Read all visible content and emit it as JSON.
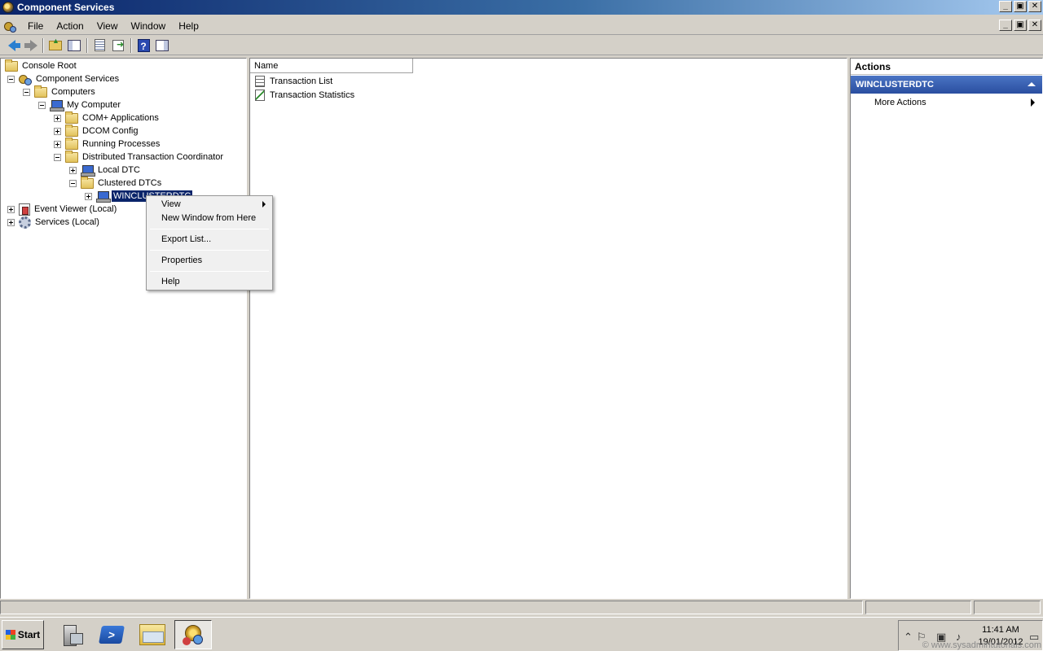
{
  "window": {
    "title": "Component Services",
    "controls": [
      "_",
      "▣",
      "✕"
    ]
  },
  "menubar": {
    "items": [
      "File",
      "Action",
      "View",
      "Window",
      "Help"
    ]
  },
  "toolbar": {
    "buttons": [
      "back-icon",
      "forward-icon",
      "up-one-level-icon",
      "show-hide-console-tree-icon",
      "export-list-icon",
      "export-icon",
      "help-icon",
      "show-hide-action-pane-icon"
    ]
  },
  "tree": {
    "nodes": [
      {
        "label": "Console Root",
        "icon": "folder-icon"
      },
      {
        "label": "Component Services",
        "icon": "component-services-icon",
        "state": "expanded"
      },
      {
        "label": "Computers",
        "icon": "folder-icon",
        "state": "expanded"
      },
      {
        "label": "My Computer",
        "icon": "computer-icon",
        "state": "expanded"
      },
      {
        "label": "COM+ Applications",
        "icon": "folder-icon",
        "state": "collapsed"
      },
      {
        "label": "DCOM Config",
        "icon": "folder-icon",
        "state": "collapsed"
      },
      {
        "label": "Running Processes",
        "icon": "folder-icon",
        "state": "collapsed"
      },
      {
        "label": "Distributed Transaction Coordinator",
        "icon": "folder-icon",
        "state": "expanded"
      },
      {
        "label": "Local DTC",
        "icon": "computer-icon",
        "state": "collapsed"
      },
      {
        "label": "Clustered DTCs",
        "icon": "folder-icon",
        "state": "expanded"
      },
      {
        "label": "WINCLUSTERDTC",
        "icon": "computer-icon",
        "state": "collapsed",
        "selected": true
      },
      {
        "label": "Event Viewer (Local)",
        "icon": "event-viewer-icon",
        "state": "collapsed"
      },
      {
        "label": "Services (Local)",
        "icon": "services-gear-icon",
        "state": "collapsed"
      }
    ]
  },
  "list": {
    "columns": [
      "Name"
    ],
    "rows": [
      {
        "label": "Transaction List",
        "icon": "transaction-list-icon"
      },
      {
        "label": "Transaction Statistics",
        "icon": "transaction-statistics-icon"
      }
    ]
  },
  "actions": {
    "title": "Actions",
    "section": "WINCLUSTERDTC",
    "items": [
      "More Actions"
    ]
  },
  "context_menu": {
    "items": [
      "View",
      "New Window from Here",
      "Export List...",
      "Properties",
      "Help"
    ]
  },
  "taskbar": {
    "start_label": "Start",
    "time": "11:41 AM",
    "date": "19/01/2012",
    "watermark": "© www.sysadmintutorials.com"
  }
}
